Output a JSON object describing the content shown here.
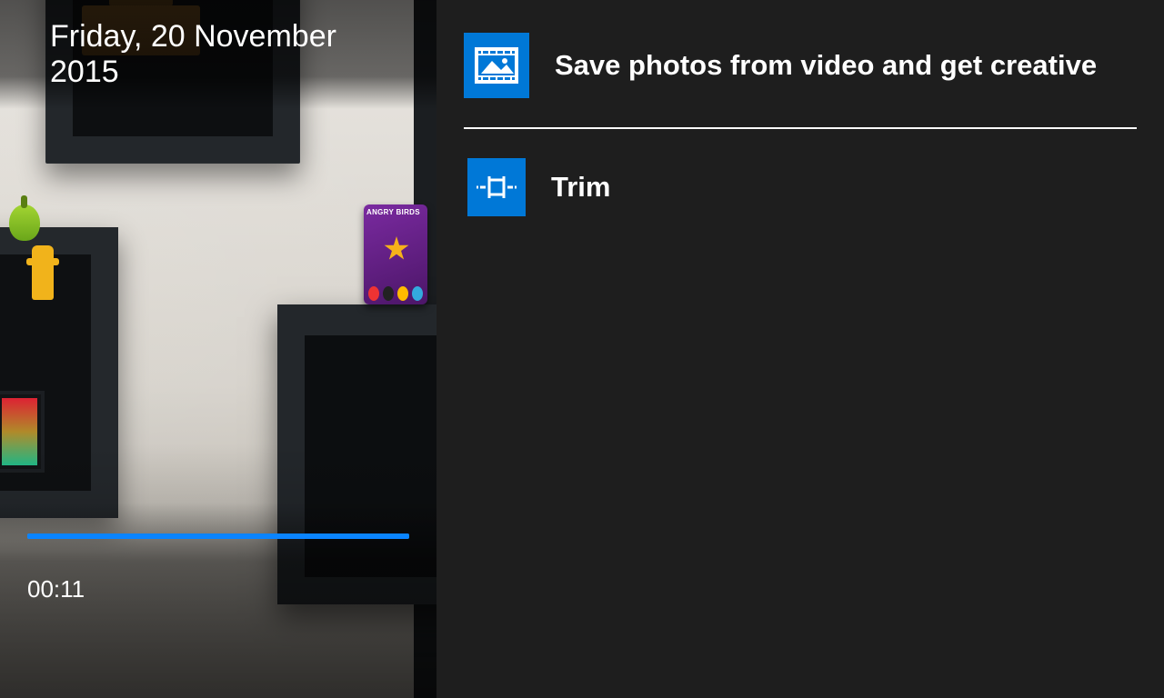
{
  "video": {
    "date_title": "Friday, 20 November 2015",
    "elapsed": "00:11",
    "progress_percent": 100
  },
  "menu": {
    "items": [
      {
        "label": "Save photos from video and get creative",
        "icon": "photo-frame-icon"
      },
      {
        "label": "Trim",
        "icon": "trim-icon"
      }
    ]
  },
  "colors": {
    "accent": "#0078d7",
    "progress": "#0a84ff"
  }
}
